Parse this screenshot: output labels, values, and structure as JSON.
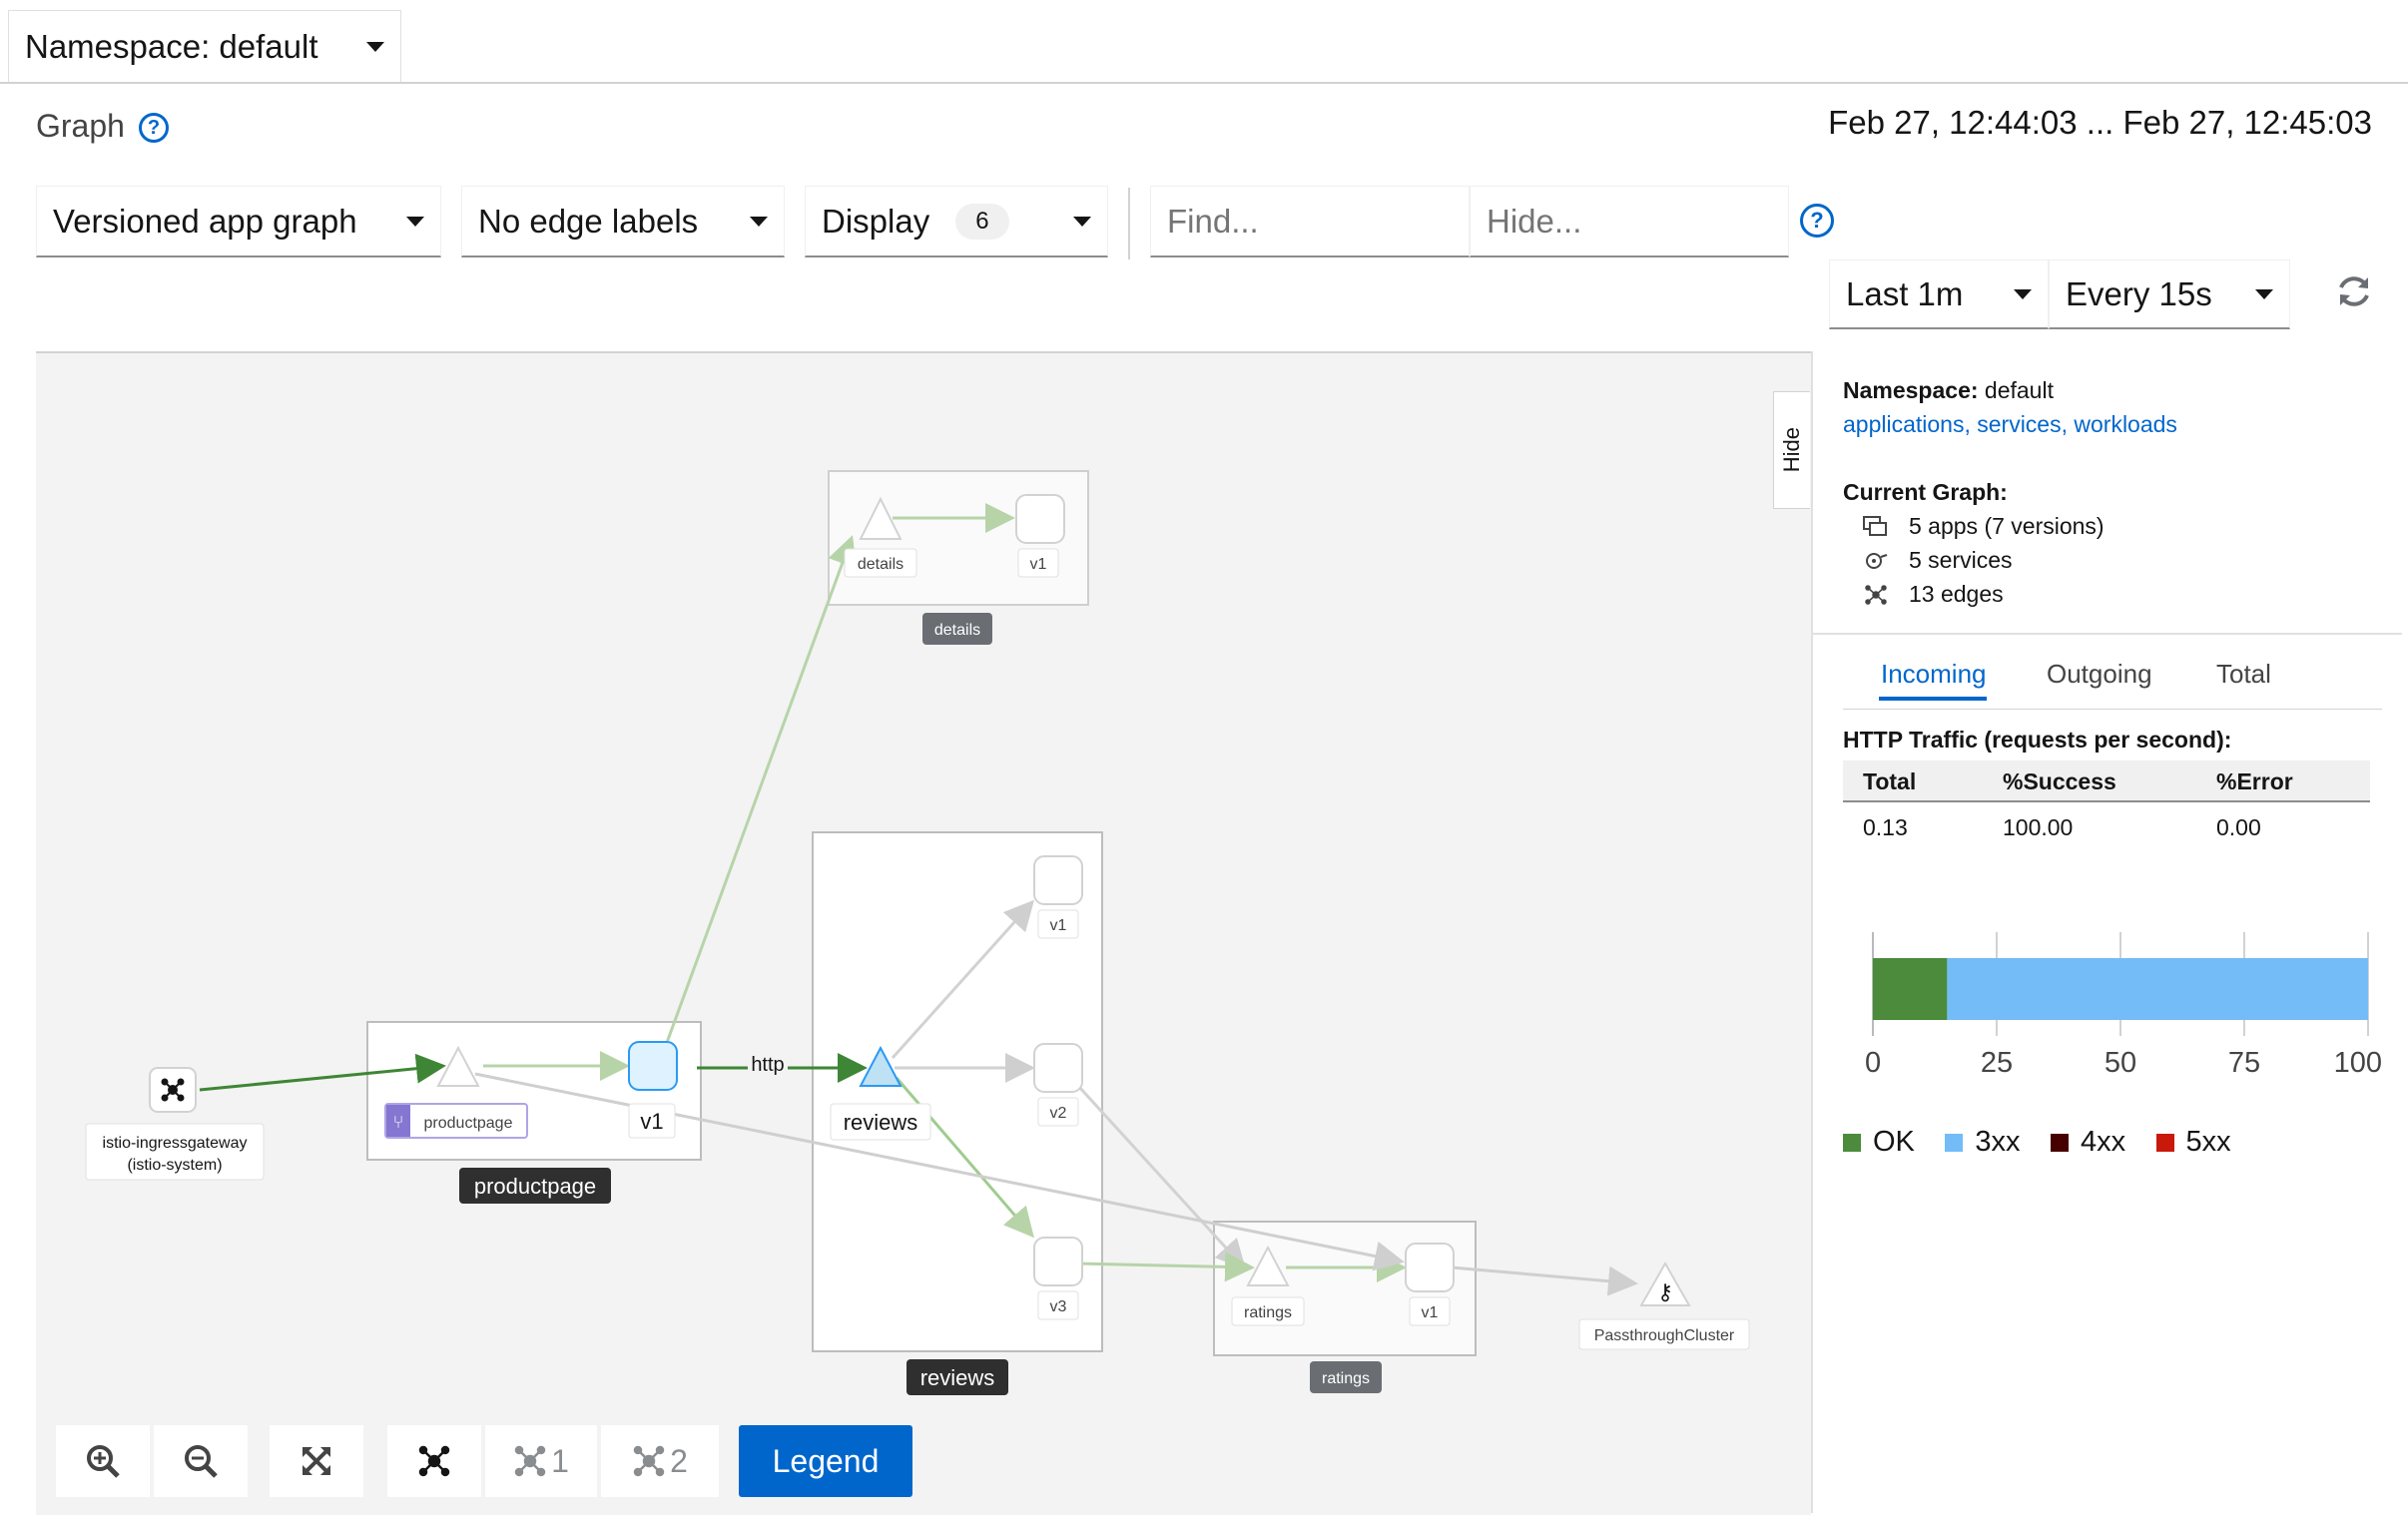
{
  "namespace_select": {
    "label": "Namespace: default"
  },
  "page": {
    "title": "Graph",
    "time_range": "Feb 27, 12:44:03 ... Feb 27, 12:45:03"
  },
  "toolbar": {
    "graph_type": "Versioned app graph",
    "edge_labels": "No edge labels",
    "display_label": "Display",
    "display_count": "6",
    "find_placeholder": "Find...",
    "hide_placeholder": "Hide...",
    "duration": "Last 1m",
    "refresh_interval": "Every 15s"
  },
  "graph": {
    "boxes": {
      "details": "details",
      "reviews": "reviews",
      "productpage": "productpage",
      "ratings": "ratings"
    },
    "nodes": {
      "details_service": "details",
      "details_v1": "v1",
      "productpage_service": "productpage",
      "productpage_v1": "v1",
      "reviews_service": "reviews",
      "reviews_v1": "v1",
      "reviews_v2": "v2",
      "reviews_v3": "v3",
      "ratings_service": "ratings",
      "ratings_v1": "v1",
      "ingress_line1": "istio-ingressgateway",
      "ingress_line2": "(istio-system)",
      "passthrough": "PassthroughCluster"
    },
    "edge_label_http": "http"
  },
  "graph_toolbar": {
    "legend_button": "Legend",
    "layout1_label": "1",
    "layout2_label": "2"
  },
  "side_panel": {
    "hide_tab": "Hide",
    "namespace_label": "Namespace:",
    "namespace_value": "default",
    "links": "applications, services, workloads",
    "current_graph_label": "Current Graph:",
    "stats": {
      "apps": "5 apps (7 versions)",
      "services": "5 services",
      "edges": "13 edges"
    },
    "tabs": [
      "Incoming",
      "Outgoing",
      "Total"
    ],
    "traffic_title": "HTTP Traffic (requests per second):",
    "table": {
      "headers": [
        "Total",
        "%Success",
        "%Error"
      ],
      "row": [
        "0.13",
        "100.00",
        "0.00"
      ]
    },
    "chart_ticks": [
      "0",
      "25",
      "50",
      "75",
      "100"
    ],
    "chart_legend": [
      "OK",
      "3xx",
      "4xx",
      "5xx"
    ],
    "colors": {
      "ok": "#4b8b3b",
      "3xx": "#73bcf7",
      "4xx": "#470000",
      "5xx": "#c9190b",
      "link": "#0066cc"
    }
  },
  "chart_data": {
    "type": "bar",
    "categories": [
      "OK",
      "3xx",
      "4xx",
      "5xx"
    ],
    "values": [
      15,
      85,
      0,
      0
    ],
    "ylim": [
      0,
      100
    ],
    "title": "",
    "xlabel": "",
    "ylabel": ""
  }
}
